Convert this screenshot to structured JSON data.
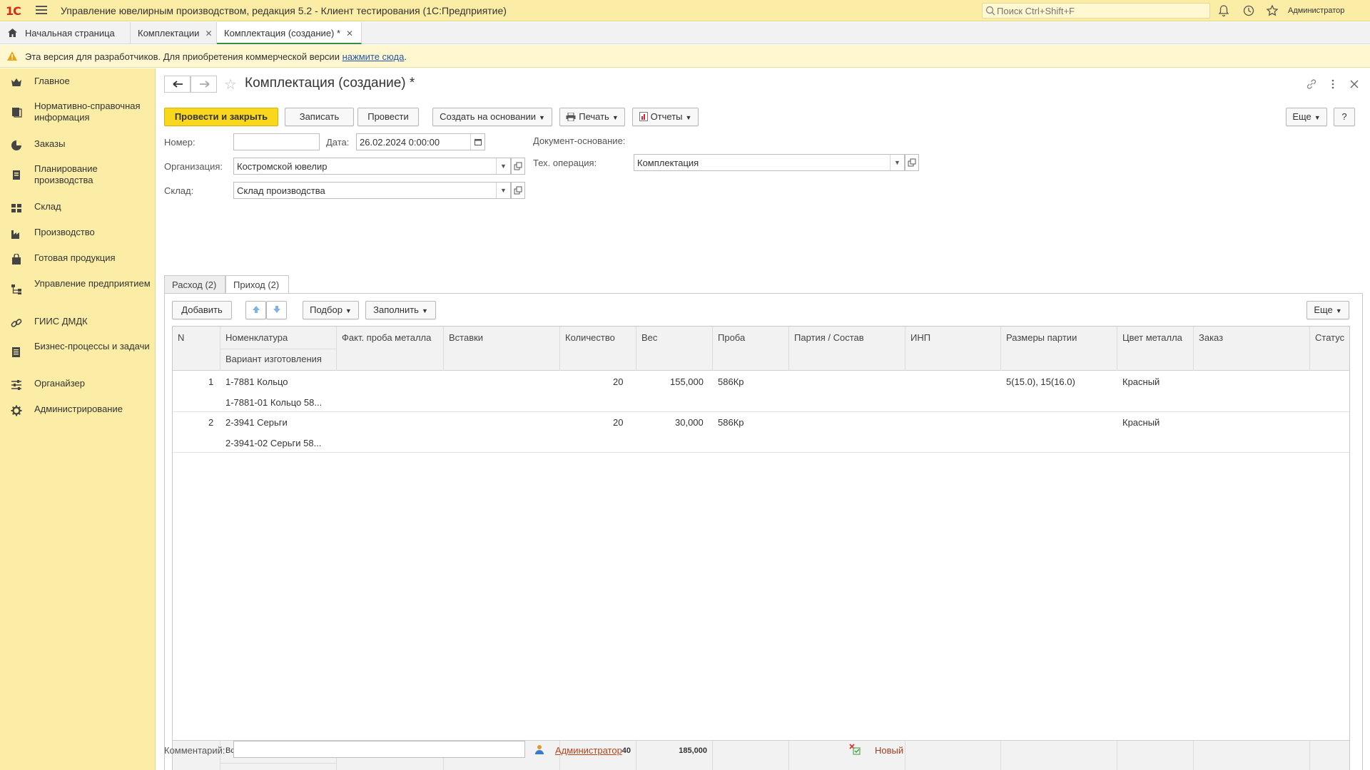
{
  "app": {
    "title": "Управление ювелирным производством, редакция 5.2  - Клиент тестирования (1С:Предприятие)",
    "logo": "1С",
    "search_placeholder": "Поиск Ctrl+Shift+F",
    "user": "Администратор"
  },
  "tabs": [
    {
      "label": "Начальная страница"
    },
    {
      "label": "Комплектации"
    },
    {
      "label": "Комплектация (создание) *"
    }
  ],
  "notice": {
    "text": "Эта версия для разработчиков. Для приобретения коммерческой версии",
    "link": "нажмите сюда",
    "tail": "."
  },
  "sidebar": {
    "items": [
      {
        "label": "Главное",
        "icon": "crown-icon"
      },
      {
        "label": "Нормативно-справочная информация",
        "icon": "book-icon"
      },
      {
        "label": "Заказы",
        "icon": "pie-icon"
      },
      {
        "label": "Планирование производства",
        "icon": "clipboard-icon"
      },
      {
        "label": "Склад",
        "icon": "grid-icon"
      },
      {
        "label": "Производство",
        "icon": "factory-icon"
      },
      {
        "label": "Готовая продукция",
        "icon": "bag-icon"
      },
      {
        "label": "Управление предприятием",
        "icon": "org-icon"
      },
      {
        "label": "ГИИС ДМДК",
        "icon": "chain-icon"
      },
      {
        "label": "Бизнес-процессы и задачи",
        "icon": "tasks-icon"
      },
      {
        "label": "Органайзер",
        "icon": "sliders-icon"
      },
      {
        "label": "Администрирование",
        "icon": "gear-icon"
      }
    ]
  },
  "form": {
    "title": "Комплектация (создание) *",
    "buttons": {
      "post_close": "Провести и закрыть",
      "save": "Записать",
      "post": "Провести",
      "create_based": "Создать на основании",
      "print": "Печать",
      "reports": "Отчеты",
      "more": "Еще",
      "help": "?"
    },
    "fields": {
      "number_label": "Номер:",
      "number_value": "",
      "date_label": "Дата:",
      "date_value": "26.02.2024  0:00:00",
      "base_doc_label": "Документ-основание:",
      "org_label": "Организация:",
      "org_value": "Костромской ювелир",
      "tech_op_label": "Тех. операция:",
      "tech_op_value": "Комплектация",
      "warehouse_label": "Склад:",
      "warehouse_value": "Склад производства"
    },
    "tabs": [
      {
        "label": "Расход (2)"
      },
      {
        "label": "Приход (2)"
      }
    ],
    "table_toolbar": {
      "add": "Добавить",
      "selection": "Подбор",
      "fill": "Заполнить",
      "more": "Еще"
    },
    "columns": {
      "n": "N",
      "nomenclature": "Номенклатура",
      "variant": "Вариант изготовления",
      "fact_probe": "Факт. проба металла",
      "inserts": "Вставки",
      "quantity": "Количество",
      "weight": "Вес",
      "probe": "Проба",
      "batch": "Партия / Состав",
      "inp": "ИНП",
      "sizes": "Размеры партии",
      "color": "Цвет металла",
      "order": "Заказ",
      "status": "Статус"
    },
    "rows": [
      {
        "n": "1",
        "nomenclature": "1-7881 Кольцо",
        "variant": "1-7881-01 Кольцо 58...",
        "quantity": "20",
        "weight": "155,000",
        "probe": "586Кр",
        "sizes": "5(15.0), 15(16.0)",
        "color": "Красный"
      },
      {
        "n": "2",
        "nomenclature": "2-3941 Серьги",
        "variant": "2-3941-02 Серьги 58...",
        "quantity": "20",
        "weight": "30,000",
        "probe": "586Кр",
        "sizes": "",
        "color": "Красный"
      }
    ],
    "totals": {
      "label": "Всего:",
      "quantity": "40",
      "weight": "185,000"
    },
    "comment_label": "Комментарий:",
    "comment_value": "",
    "author": "Администратор",
    "status": "Новый"
  },
  "colors": {
    "accent_yellow": "#f9d71c",
    "sidebar_bg": "#fbeda5",
    "link": "#b5441c",
    "active_tab_border": "#3a8f3a"
  }
}
